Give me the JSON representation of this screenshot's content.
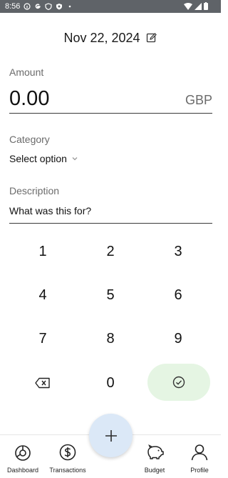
{
  "status_bar": {
    "time": "8:56"
  },
  "header": {
    "date": "Nov 22, 2024"
  },
  "amount": {
    "label": "Amount",
    "value": "0.00",
    "currency": "GBP"
  },
  "category": {
    "label": "Category",
    "selected": "Select option"
  },
  "description": {
    "label": "Description",
    "placeholder": "What was this for?"
  },
  "keypad": {
    "keys": [
      "1",
      "2",
      "3",
      "4",
      "5",
      "6",
      "7",
      "8",
      "9",
      "0"
    ]
  },
  "nav": {
    "items": [
      {
        "label": "Dashboard",
        "icon": "dashboard-chart-icon"
      },
      {
        "label": "Transactions",
        "icon": "dollar-circle-icon"
      },
      {
        "label": "Budget",
        "icon": "piggy-bank-icon"
      },
      {
        "label": "Profile",
        "icon": "person-icon"
      }
    ],
    "fab_icon": "plus-icon"
  },
  "colors": {
    "accent_fab": "#dbe8f7",
    "confirm_bg": "#e5f5e3",
    "status_bar": "#5f6368"
  }
}
